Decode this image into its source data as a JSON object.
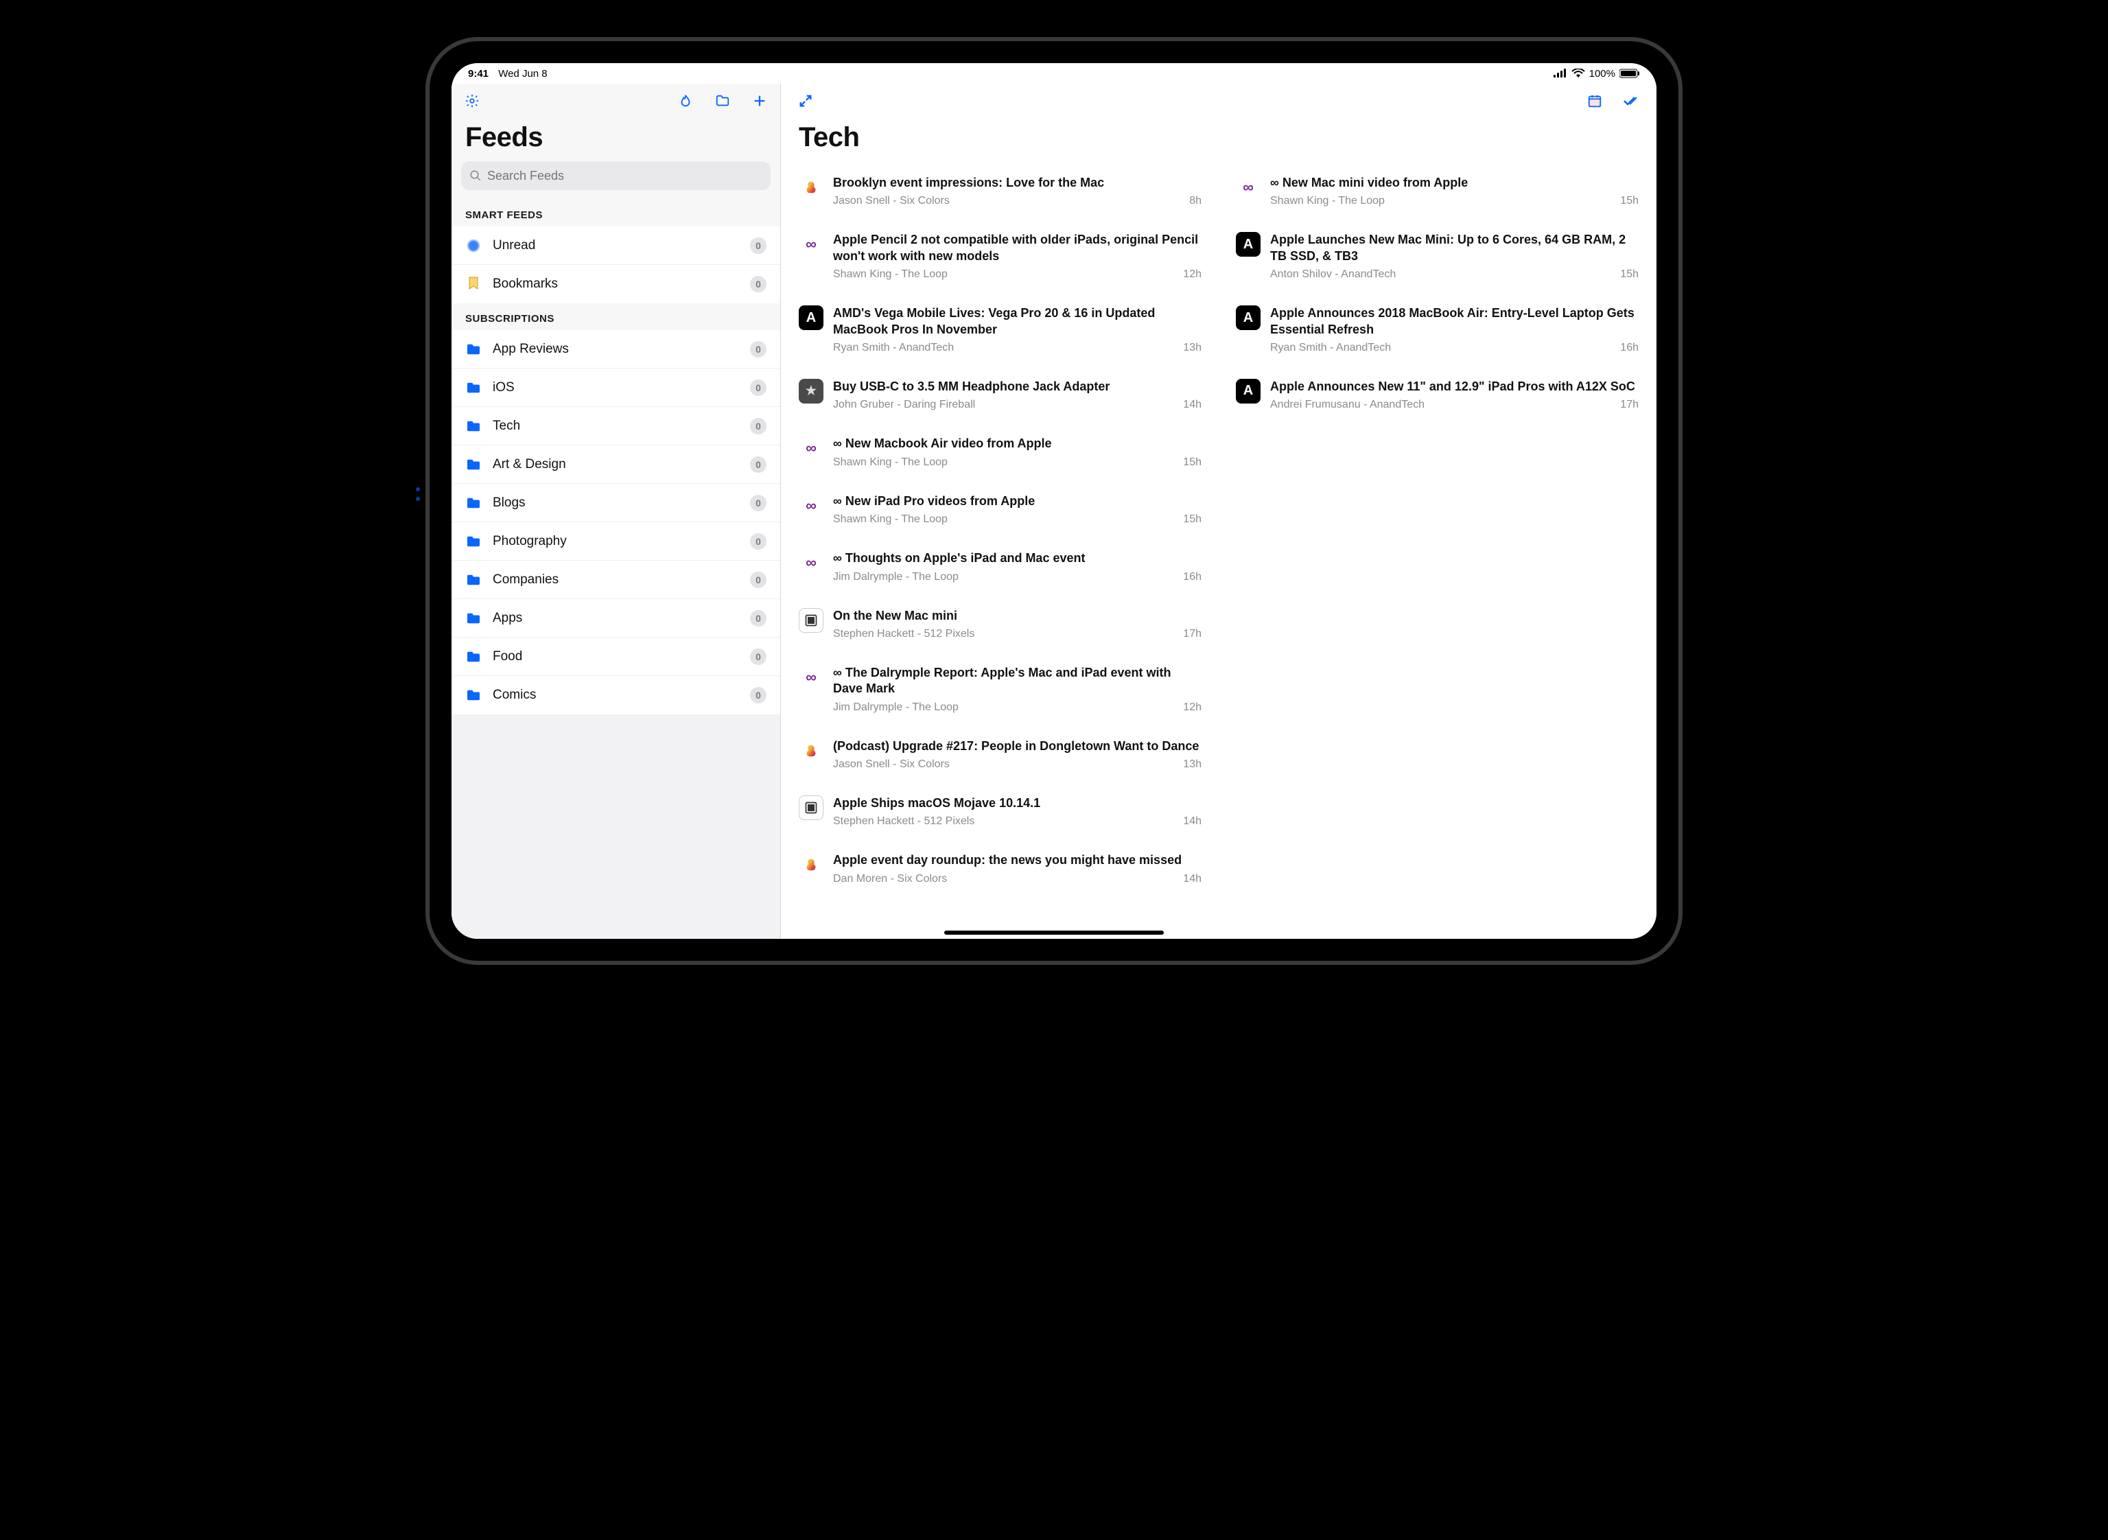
{
  "status": {
    "time": "9:41",
    "date": "Wed Jun 8",
    "battery": "100%"
  },
  "sidebar": {
    "title": "Feeds",
    "search_placeholder": "Search Feeds",
    "smart_label": "SMART FEEDS",
    "subs_label": "SUBSCRIPTIONS",
    "smart": [
      {
        "label": "Unread",
        "count": "0",
        "icon": "unread"
      },
      {
        "label": "Bookmarks",
        "count": "0",
        "icon": "bookmark"
      }
    ],
    "subs": [
      {
        "label": "App Reviews",
        "count": "0"
      },
      {
        "label": "iOS",
        "count": "0"
      },
      {
        "label": "Tech",
        "count": "0"
      },
      {
        "label": "Art & Design",
        "count": "0"
      },
      {
        "label": "Blogs",
        "count": "0"
      },
      {
        "label": "Photography",
        "count": "0"
      },
      {
        "label": "Companies",
        "count": "0"
      },
      {
        "label": "Apps",
        "count": "0"
      },
      {
        "label": "Food",
        "count": "0"
      },
      {
        "label": "Comics",
        "count": "0"
      }
    ]
  },
  "main": {
    "title": "Tech",
    "articles": [
      {
        "title": "Brooklyn event impressions: Love for the Mac",
        "source": "Jason Snell - Six Colors",
        "time": "8h",
        "icon": "sixcolors"
      },
      {
        "title": "Apple Pencil 2 not compatible with older iPads, original Pencil won't work with new models",
        "source": "Shawn King - The Loop",
        "time": "12h",
        "icon": "loop"
      },
      {
        "title": "AMD's Vega Mobile Lives: Vega Pro 20 & 16 in Updated MacBook Pros In November",
        "source": "Ryan Smith - AnandTech",
        "time": "13h",
        "icon": "anand"
      },
      {
        "title": "Buy USB-C to 3.5 MM Headphone Jack Adapter",
        "source": "John Gruber - Daring Fireball",
        "time": "14h",
        "icon": "df"
      },
      {
        "title": "∞ New Macbook Air video from Apple",
        "source": "Shawn King - The Loop",
        "time": "15h",
        "icon": "loop"
      },
      {
        "title": "∞ New iPad Pro videos from Apple",
        "source": "Shawn King - The Loop",
        "time": "15h",
        "icon": "loop"
      },
      {
        "title": "∞ Thoughts on Apple's iPad and Mac event",
        "source": "Jim Dalrymple - The Loop",
        "time": "16h",
        "icon": "loop"
      },
      {
        "title": "On the New Mac mini",
        "source": "Stephen Hackett - 512 Pixels",
        "time": "17h",
        "icon": "pix"
      },
      {
        "title": "∞ The Dalrymple Report: Apple's Mac and iPad event with Dave Mark",
        "source": "Jim Dalrymple - The Loop",
        "time": "12h",
        "icon": "loop"
      },
      {
        "title": "(Podcast) Upgrade #217: People in Dongletown Want to Dance",
        "source": "Jason Snell - Six Colors",
        "time": "13h",
        "icon": "sixcolors"
      },
      {
        "title": "Apple Ships macOS Mojave 10.14.1",
        "source": "Stephen Hackett - 512 Pixels",
        "time": "14h",
        "icon": "pix"
      },
      {
        "title": "Apple event day roundup: the news you might have missed",
        "source": "Dan Moren - Six Colors",
        "time": "14h",
        "icon": "sixcolors"
      },
      {
        "title": "∞ New Mac mini video from Apple",
        "source": "Shawn King - The Loop",
        "time": "15h",
        "icon": "loop"
      },
      {
        "title": "Apple Launches New Mac Mini: Up to 6 Cores, 64 GB RAM, 2 TB SSD, & TB3",
        "source": "Anton Shilov - AnandTech",
        "time": "15h",
        "icon": "anand"
      },
      {
        "title": "Apple Announces 2018 MacBook Air: Entry-Level Laptop Gets Essential Refresh",
        "source": "Ryan Smith - AnandTech",
        "time": "16h",
        "icon": "anand"
      },
      {
        "title": "Apple Announces New 11\" and 12.9\" iPad Pros with A12X SoC",
        "source": "Andrei Frumusanu - AnandTech",
        "time": "17h",
        "icon": "anand"
      }
    ]
  }
}
